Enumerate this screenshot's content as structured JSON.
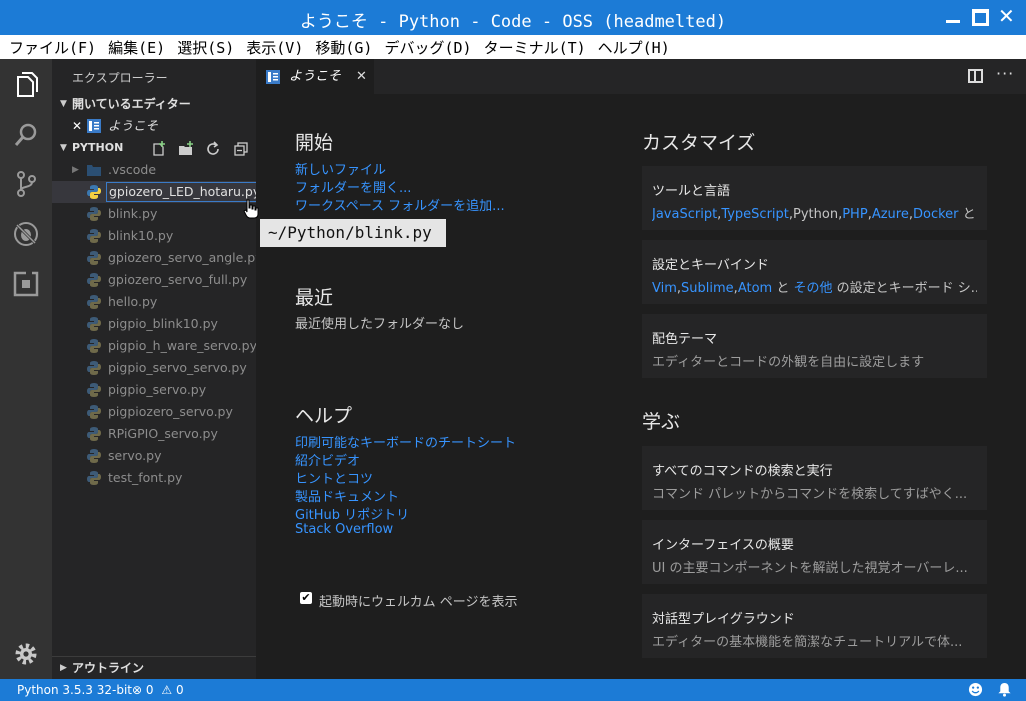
{
  "window": {
    "title": "ようこそ - Python - Code - OSS (headmelted)",
    "min_icon": "minimize-icon",
    "max_icon": "maximize-icon",
    "close_label": "✕"
  },
  "menu": [
    "ファイル(F)",
    "編集(E)",
    "選択(S)",
    "表示(V)",
    "移動(G)",
    "デバッグ(D)",
    "ターミナル(T)",
    "ヘルプ(H)"
  ],
  "sidebar": {
    "header": "エクスプローラー",
    "open_editors_label": "開いているエディター",
    "open_editor_item": "ようこそ",
    "folder_label": "PYTHON",
    "outline_label": "アウトライン",
    "files": [
      ".vscode",
      "gpiozero_LED_hotaru.py",
      "blink.py",
      "blink10.py",
      "gpiozero_servo_angle.py",
      "gpiozero_servo_full.py",
      "hello.py",
      "pigpio_blink10.py",
      "pigpio_h_ware_servo.py",
      "pigpio_servo_servo.py",
      "pigpio_servo.py",
      "pigpiozero_servo.py",
      "RPiGPIO_servo.py",
      "servo.py",
      "test_font.py"
    ],
    "tooltip": "~/Python/blink.py"
  },
  "tab": {
    "label": "ようこそ",
    "close": "✕"
  },
  "welcome": {
    "start_title": "開始",
    "start_links": [
      "新しいファイル",
      "フォルダーを開く...",
      "ワークスペース フォルダーを追加..."
    ],
    "recent_title": "最近",
    "recent_empty": "最近使用したフォルダーなし",
    "help_title": "ヘルプ",
    "help_links": [
      "印刷可能なキーボードのチートシート",
      "紹介ビデオ",
      "ヒントとコツ",
      "製品ドキュメント",
      "GitHub リポジトリ",
      "Stack Overflow"
    ],
    "show_on_startup": "起動時にウェルカム ページを表示",
    "customize_title": "カスタマイズ",
    "learn_title": "学ぶ",
    "cards": [
      {
        "title": "ツールと言語"
      },
      {
        "title": "設定とキーバインド"
      },
      {
        "title": "配色テーマ",
        "desc": "エディターとコードの外観を自由に設定します"
      },
      {
        "title": "すべてのコマンドの検索と実行",
        "desc": "コマンド パレットからコマンドを検索してすばやく..."
      },
      {
        "title": "インターフェイスの概要",
        "desc": "UI の主要コンポーネントを解説した視覚オーバーレ..."
      },
      {
        "title": "対話型プレイグラウンド",
        "desc": "エディターの基本機能を簡潔なチュートリアルで体..."
      }
    ],
    "tools_items": [
      "JavaScript",
      ",",
      "TypeScript",
      ",Python,",
      "PHP",
      ",",
      "Azure",
      ",",
      "Docker",
      " と ..."
    ],
    "keymap_items": [
      "Vim",
      ",",
      "Sublime",
      ",",
      "Atom",
      " と ",
      "その他",
      " の設定とキーボード シ..."
    ]
  },
  "status": {
    "interpreter": "Python 3.5.3 32-bit",
    "errors": "0",
    "warnings": "0"
  },
  "colors": {
    "accent": "#1c7bd6",
    "link": "#3794ff"
  }
}
